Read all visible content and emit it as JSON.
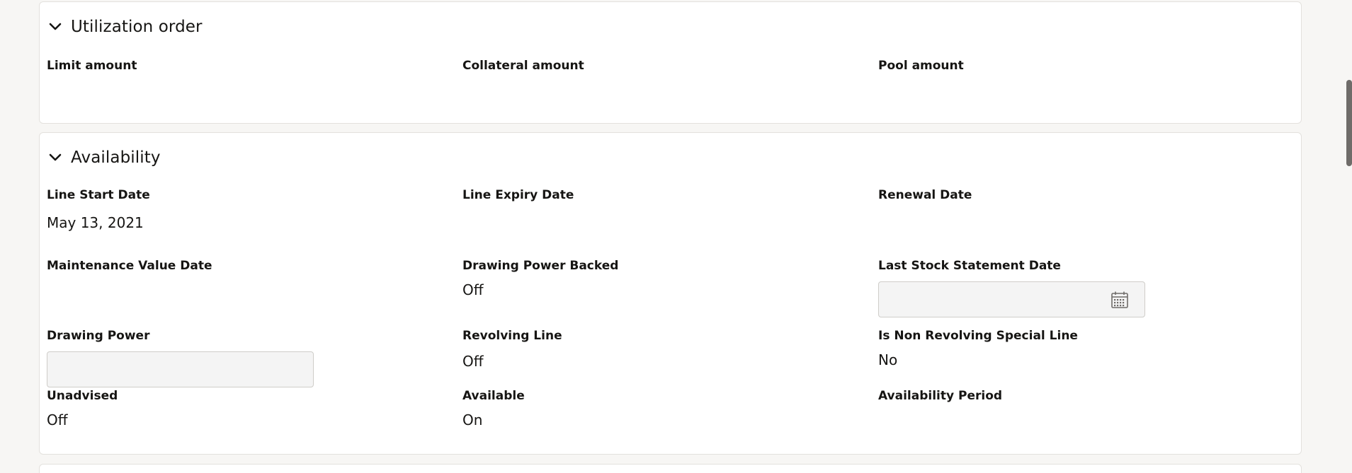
{
  "utilization": {
    "title": "Utilization order",
    "fields": [
      {
        "label": "Limit amount",
        "value": ""
      },
      {
        "label": "Collateral amount",
        "value": ""
      },
      {
        "label": "Pool amount",
        "value": ""
      }
    ]
  },
  "availability": {
    "title": "Availability",
    "line_start_date": {
      "label": "Line Start Date",
      "value": "May 13, 2021"
    },
    "line_expiry_date": {
      "label": "Line Expiry Date",
      "value": ""
    },
    "renewal_date": {
      "label": "Renewal Date",
      "value": ""
    },
    "maintenance_value_date": {
      "label": "Maintenance Value Date",
      "value": ""
    },
    "drawing_power_backed": {
      "label": "Drawing Power Backed",
      "value": "Off"
    },
    "last_stock_statement_date": {
      "label": "Last Stock Statement Date",
      "value": ""
    },
    "drawing_power": {
      "label": "Drawing Power",
      "value": ""
    },
    "revolving_line": {
      "label": "Revolving Line",
      "value": "Off"
    },
    "non_revolving_special_line": {
      "label": "Is Non Revolving Special Line",
      "value": "No"
    },
    "unadvised": {
      "label": "Unadvised",
      "value": "Off"
    },
    "available": {
      "label": "Available",
      "value": "On"
    },
    "availability_period": {
      "label": "Availability Period",
      "value": ""
    }
  },
  "icons": {
    "section_toggle": "chevron-down-icon",
    "date_picker": "calendar-icon"
  },
  "colors": {
    "page_background": "#f7f6f4",
    "panel_background": "#ffffff",
    "panel_border": "#e3e1dd",
    "text": "#161513",
    "input_background": "#f4f4f4",
    "input_border": "#cfcdc9",
    "scrollbar": "#6f6c69"
  }
}
